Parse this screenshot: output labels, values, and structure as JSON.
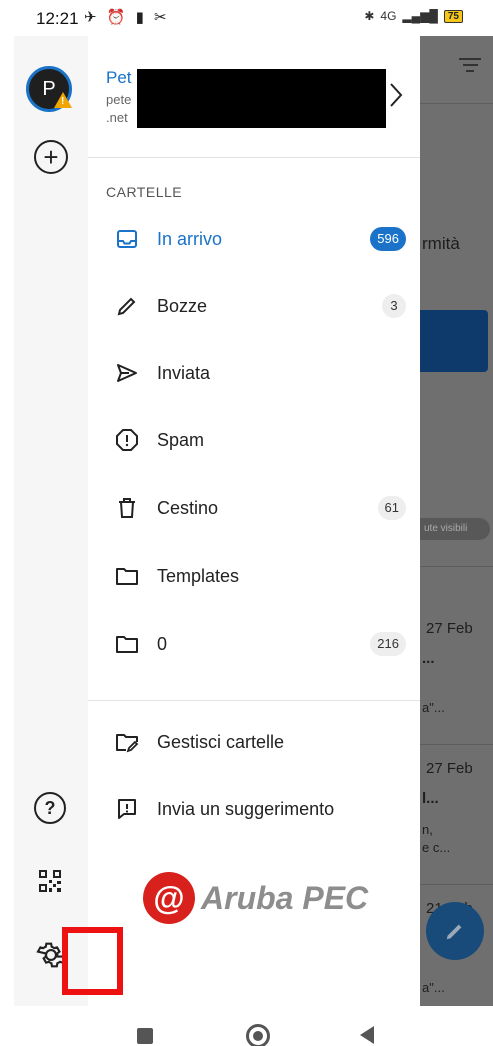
{
  "status_bar": {
    "time": "12:21",
    "left_icons": "✈ ⏰ ▮ ✂",
    "network": "4G",
    "battery": "75"
  },
  "account": {
    "name": "Pet",
    "email_line1": "pete",
    "email_line2": ".net"
  },
  "folders_section_title": "CARTELLE",
  "folders": [
    {
      "label": "In arrivo",
      "icon": "inbox-icon",
      "count": "596"
    },
    {
      "label": "Bozze",
      "icon": "pencil-icon",
      "count": "3"
    },
    {
      "label": "Inviata",
      "icon": "send-icon",
      "count": ""
    },
    {
      "label": "Spam",
      "icon": "spam-icon",
      "count": ""
    },
    {
      "label": "Cestino",
      "icon": "trash-icon",
      "count": "61"
    },
    {
      "label": "Templates",
      "icon": "folder-icon",
      "count": ""
    },
    {
      "label": "0",
      "icon": "folder-icon",
      "count": "216"
    }
  ],
  "actions": {
    "manage_folders": "Gestisci cartelle",
    "send_feedback": "Invia un suggerimento"
  },
  "logo": {
    "mark": "@",
    "text": "Aruba PEC"
  },
  "avatar_initial": "P",
  "background": {
    "text_1": "rmità",
    "pill": "ute visibili",
    "date_1": "27 Feb",
    "snippet_1a": "...",
    "snippet_1b": "a\"...",
    "date_2": "27 Feb",
    "snippet_2a": "l...",
    "snippet_2b": "n,",
    "snippet_2c": "e c...",
    "date_3": "21 Feb",
    "snippet_3a": "a\"..."
  },
  "colors": {
    "accent": "#1a73c8",
    "brand_red": "#d8211d",
    "highlight": "#ee1111"
  }
}
